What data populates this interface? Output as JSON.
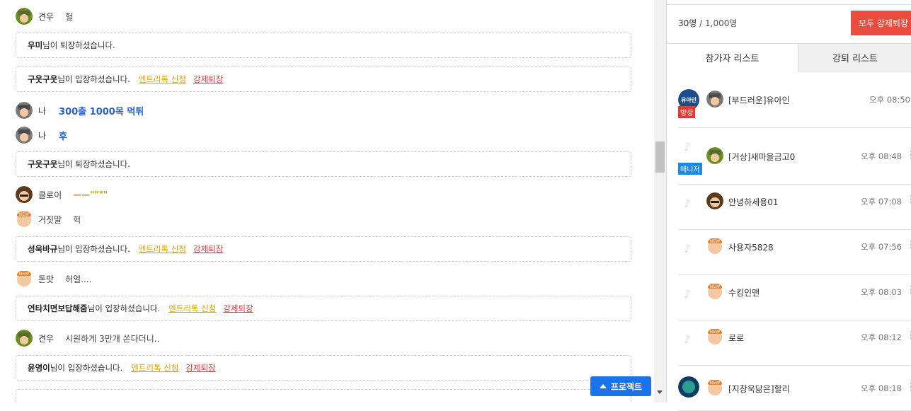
{
  "chat": {
    "rows": [
      {
        "type": "msg",
        "nick": "견우",
        "text": "헐"
      },
      {
        "type": "sys",
        "name": "우미",
        "suffix": "님이 퇴장하셨습니다."
      },
      {
        "type": "sys",
        "name": "구웃구웃",
        "suffix": "님이 입장하셨습니다.",
        "entry": "엔트리톡 신청",
        "kick": "강제퇴장"
      },
      {
        "type": "msg",
        "nick": "나",
        "text": "300출 1000목 먹튀"
      },
      {
        "type": "msg",
        "nick": "나",
        "text": "후"
      },
      {
        "type": "sys",
        "name": "구웃구웃",
        "suffix": "님이 퇴장하셨습니다."
      },
      {
        "type": "msg",
        "nick": "클로이",
        "text": "——\"\"\"\""
      },
      {
        "type": "msg",
        "nick": "거짓말",
        "text": "헉"
      },
      {
        "type": "sys",
        "name": "성욱바규",
        "suffix": "님이 입장하셨습니다.",
        "entry": "엔트리톡 신청",
        "kick": "강제퇴장"
      },
      {
        "type": "msg",
        "nick": "돈맛",
        "text": "허얼...."
      },
      {
        "type": "sys",
        "name": "연타치면보답해줌",
        "suffix": "님이 입장하셨습니다.",
        "entry": "엔트리톡 신청",
        "kick": "강제퇴장"
      },
      {
        "type": "msg",
        "nick": "견우",
        "text": "시원하게 3만개 쏜다더니.."
      },
      {
        "type": "sys",
        "name": "윤영이",
        "suffix": "님이 입장하셨습니다.",
        "entry": "엔트리톡 신청",
        "kick": "강제퇴장"
      }
    ],
    "project_button": "프로젝트"
  },
  "panel": {
    "count": "30명",
    "max": "/ 1,000명",
    "kick_all": "모두 강제퇴장",
    "tabs": {
      "participants": "참가자 리스트",
      "kicked": "강퇴 리스트"
    },
    "participants": [
      {
        "name": "[부드러운]유아인",
        "time": "오후 08:50",
        "role": "방장",
        "role_color": "#e53935",
        "badge": "유아인"
      },
      {
        "name": "[거상]새마을금고0",
        "time": "오후 08:48",
        "role": "매니저",
        "role_color": "#1e88e5"
      },
      {
        "name": "안녕하세용01",
        "time": "오후 07:08"
      },
      {
        "name": "사용자5828",
        "time": "오후 07:56"
      },
      {
        "name": "수킹인맨",
        "time": "오후 08:03"
      },
      {
        "name": "로로",
        "time": "오후 08:12"
      },
      {
        "name": "[지창욱닮은]할리",
        "time": "오후 08:18"
      }
    ]
  },
  "colors": {
    "accent": "#1a73e8",
    "kick": "#e53935",
    "entry": "#e0a100",
    "kick_all_bg": "#ea4c3e"
  }
}
